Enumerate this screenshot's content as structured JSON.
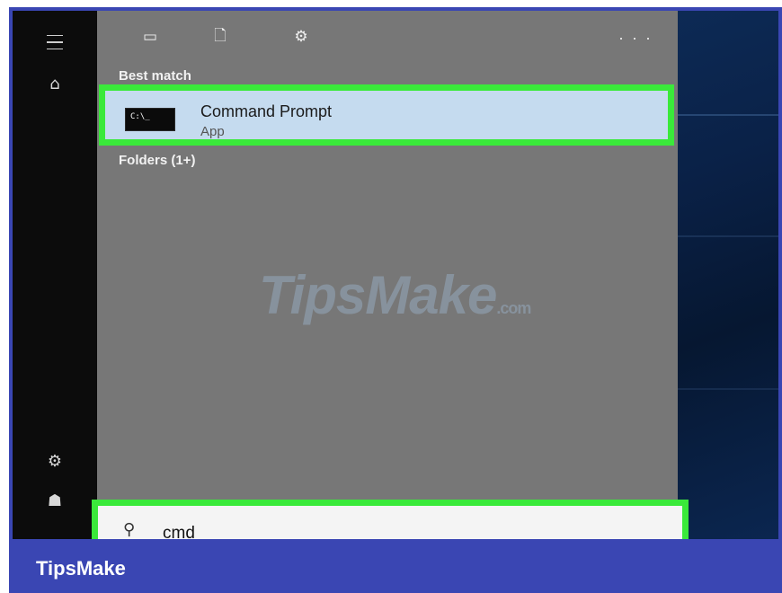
{
  "start_menu": {
    "top_icons": [
      "apps-icon",
      "documents-icon",
      "settings-icon"
    ],
    "more_label": "· · ·",
    "best_match_label": "Best match",
    "best_match": {
      "title": "Command Prompt",
      "subtitle": "App",
      "icon_text": "C:\\_"
    },
    "folders_label": "Folders (1+)"
  },
  "search": {
    "value": "cmd"
  },
  "watermark": {
    "text": "TipsMake",
    "suffix": ".com"
  },
  "caption": "TipsMake",
  "colors": {
    "highlight": "#3ae93a",
    "frame": "#3a46b3",
    "panel": "#777777"
  }
}
